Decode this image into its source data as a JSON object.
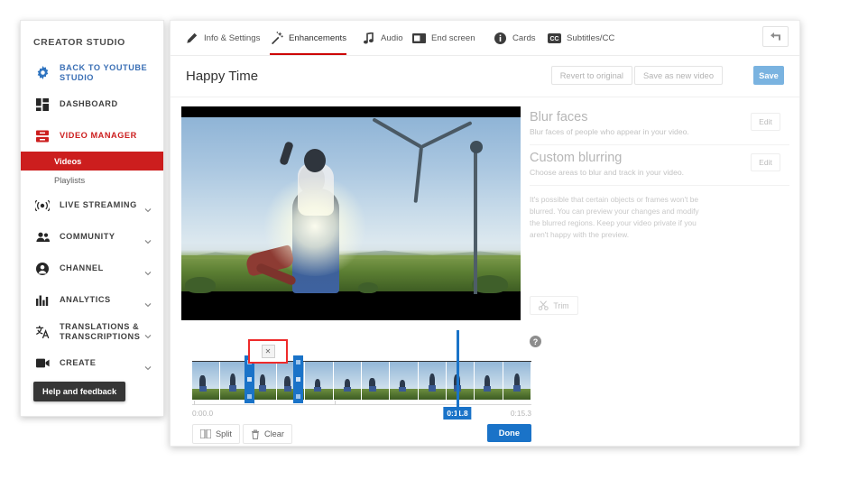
{
  "sidebar": {
    "title": "CREATOR STUDIO",
    "items": [
      {
        "label": "BACK TO YOUTUBE STUDIO",
        "icon": "gear-icon",
        "style": "blue",
        "chevron": false
      },
      {
        "label": "DASHBOARD",
        "icon": "dashboard-icon",
        "style": "dark",
        "chevron": false
      },
      {
        "label": "VIDEO MANAGER",
        "icon": "video-manager-icon",
        "style": "red",
        "chevron": false
      },
      {
        "label": "LIVE STREAMING",
        "icon": "live-streaming-icon",
        "style": "dark",
        "chevron": true
      },
      {
        "label": "COMMUNITY",
        "icon": "community-icon",
        "style": "dark",
        "chevron": true
      },
      {
        "label": "CHANNEL",
        "icon": "channel-icon",
        "style": "dark",
        "chevron": true
      },
      {
        "label": "ANALYTICS",
        "icon": "analytics-icon",
        "style": "dark",
        "chevron": true
      },
      {
        "label": "TRANSLATIONS & TRANSCRIPTIONS",
        "icon": "translations-icon",
        "style": "dark",
        "chevron": true
      },
      {
        "label": "CREATE",
        "icon": "create-icon",
        "style": "dark",
        "chevron": true
      }
    ],
    "sub_items": [
      {
        "label": "Videos",
        "active": true
      },
      {
        "label": "Playlists",
        "active": false
      }
    ],
    "help_button": "Help and feedback",
    "accent_red": "#cc1e1e",
    "accent_blue": "#3a6fb5"
  },
  "tabs": [
    {
      "label": "Info & Settings",
      "icon": "pencil-icon",
      "active": false
    },
    {
      "label": "Enhancements",
      "icon": "magic-wand-icon",
      "active": true
    },
    {
      "label": "Audio",
      "icon": "music-note-icon",
      "active": false
    },
    {
      "label": "End screen",
      "icon": "end-screen-icon",
      "active": false
    },
    {
      "label": "Cards",
      "icon": "info-circle-icon",
      "active": false
    },
    {
      "label": "Subtitles/CC",
      "icon": "closed-caption-icon",
      "active": false
    }
  ],
  "header": {
    "video_title": "Happy Time",
    "revert_label": "Revert to original",
    "save_as_new_label": "Save as new video",
    "save_label": "Save",
    "save_color": "#7ab3e0",
    "back_icon": "undo-arrow-icon"
  },
  "options": [
    {
      "title": "Blur faces",
      "desc": "Blur faces of people who appear in your video.",
      "edit_label": "Edit"
    },
    {
      "title": "Custom blurring",
      "desc": "Choose areas to blur and track in your video.",
      "edit_label": "Edit"
    }
  ],
  "note": "It's possible that certain objects or frames won't be blurred. You can preview your changes and modify the blurred regions. Keep your video private if you aren't happy with the preview.",
  "trim": {
    "label": "Trim",
    "icon": "scissors-icon"
  },
  "help_icon": "question-mark-icon",
  "timeline": {
    "delete_segment_label": "✕",
    "start_time": "0:00.0",
    "end_time": "0:15.3",
    "playhead_time": "0:11.8",
    "playhead_pct": 78.2,
    "handle_left_pct": 16.8,
    "handle_right_pct": 31.2,
    "frame_count": 12,
    "tick_positions": [
      0.5,
      18,
      42
    ],
    "accent_blue": "#1a73c8",
    "highlight_red": "#ee2b2b"
  },
  "controls": {
    "split_label": "Split",
    "split_icon": "split-icon",
    "clear_label": "Clear",
    "clear_icon": "trash-icon",
    "done_label": "Done"
  }
}
